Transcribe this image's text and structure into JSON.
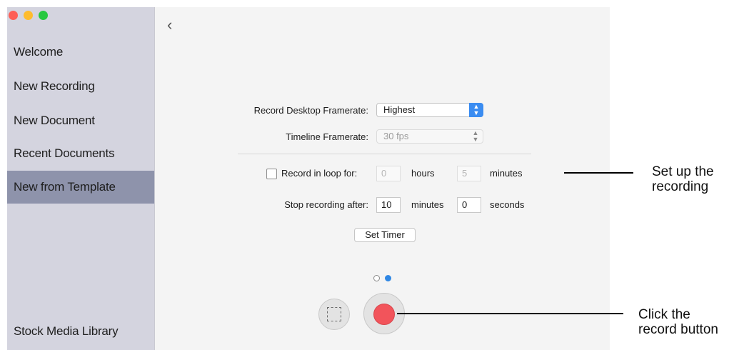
{
  "sidebar": {
    "items": [
      {
        "label": "Welcome"
      },
      {
        "label": "New Recording"
      },
      {
        "label": "New Document"
      },
      {
        "label": "Recent Documents"
      },
      {
        "label": "New from Template",
        "active": true
      }
    ],
    "footer_item": "Stock Media Library"
  },
  "toolbar": {
    "back_icon": "chevron-left-icon",
    "back_glyph": "‹"
  },
  "form": {
    "desktop_framerate_label": "Record Desktop Framerate:",
    "desktop_framerate_value": "Highest",
    "timeline_framerate_label": "Timeline Framerate:",
    "timeline_framerate_value": "30 fps",
    "loop_checkbox_label": "Record in loop for:",
    "loop_checked": false,
    "loop_hours_value": "0",
    "loop_hours_unit": "hours",
    "loop_minutes_value": "5",
    "loop_minutes_unit": "minutes",
    "stop_after_label": "Stop recording after:",
    "stop_minutes_value": "10",
    "stop_minutes_unit": "minutes",
    "stop_seconds_value": "0",
    "stop_seconds_unit": "seconds",
    "set_timer_label": "Set Timer"
  },
  "pager": {
    "pages": 2,
    "current": 2
  },
  "controls": {
    "region_icon": "region-select-icon",
    "record_icon": "record-icon"
  },
  "callouts": {
    "setup_line1": "Set up the",
    "setup_line2": "recording",
    "record_line1": "Click the",
    "record_line2": "record button"
  },
  "colors": {
    "sidebar_bg": "#d4d4df",
    "sidebar_active": "#8e93ab",
    "accent_blue": "#3a8cf1",
    "record_red": "#f2545b"
  }
}
